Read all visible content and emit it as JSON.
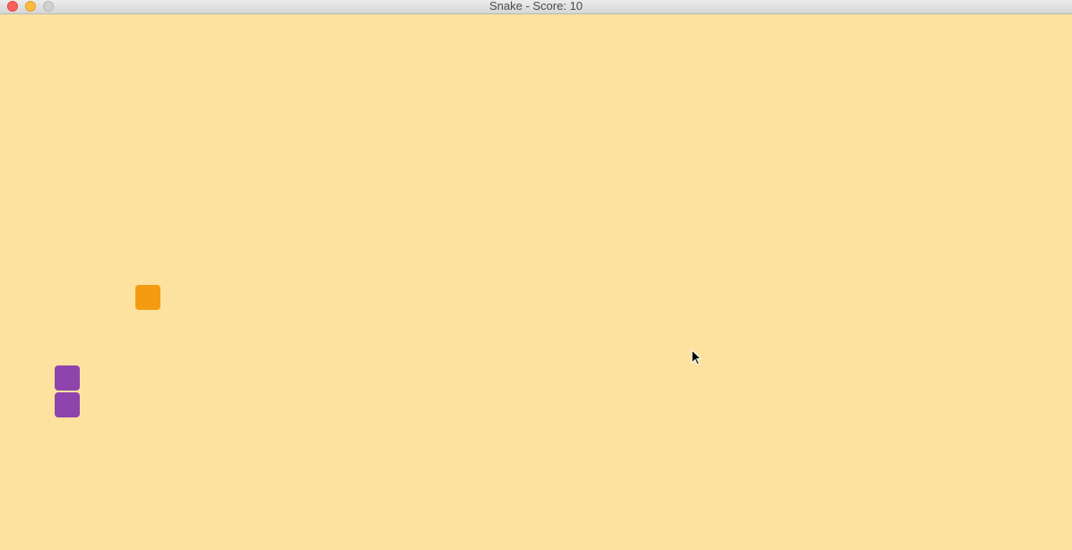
{
  "window": {
    "title": "Snake - Score: 10"
  },
  "colors": {
    "background": "#fde29f",
    "snake": "#8e44ad",
    "food": "#f39c12"
  },
  "icons": {
    "close": "close-icon",
    "minimize": "minimize-icon",
    "zoom": "zoom-icon",
    "cursor": "mouse-pointer-icon"
  }
}
